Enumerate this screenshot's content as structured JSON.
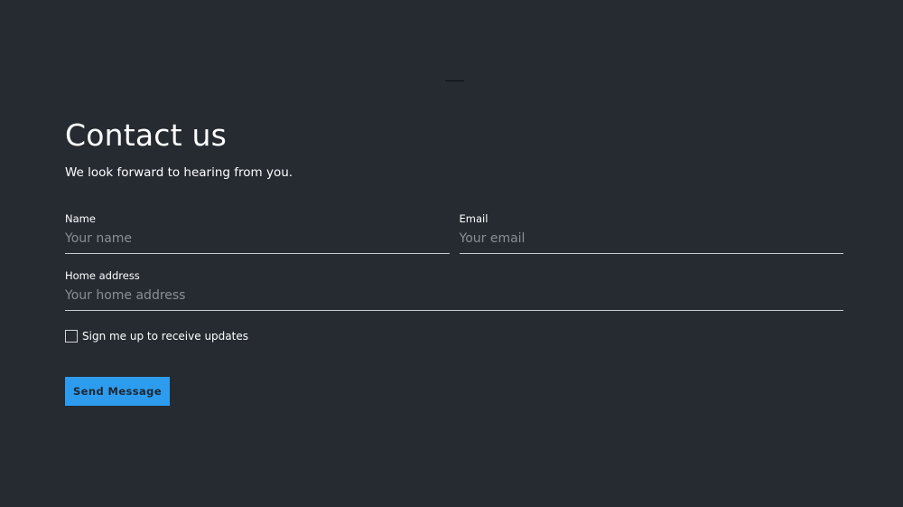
{
  "contact": {
    "title": "Contact us",
    "subtitle": "We look forward to hearing from you."
  },
  "form": {
    "name": {
      "label": "Name",
      "placeholder": "Your name",
      "value": ""
    },
    "email": {
      "label": "Email",
      "placeholder": "Your email",
      "value": ""
    },
    "address": {
      "label": "Home address",
      "placeholder": "Your home address",
      "value": ""
    },
    "updates_checkbox": {
      "label": "Sign me up to receive updates",
      "checked": false
    },
    "submit_label": "Send Message"
  },
  "colors": {
    "background": "#262a31",
    "accent": "#2d9cee",
    "text": "#ffffff",
    "placeholder": "#8a8e95"
  }
}
